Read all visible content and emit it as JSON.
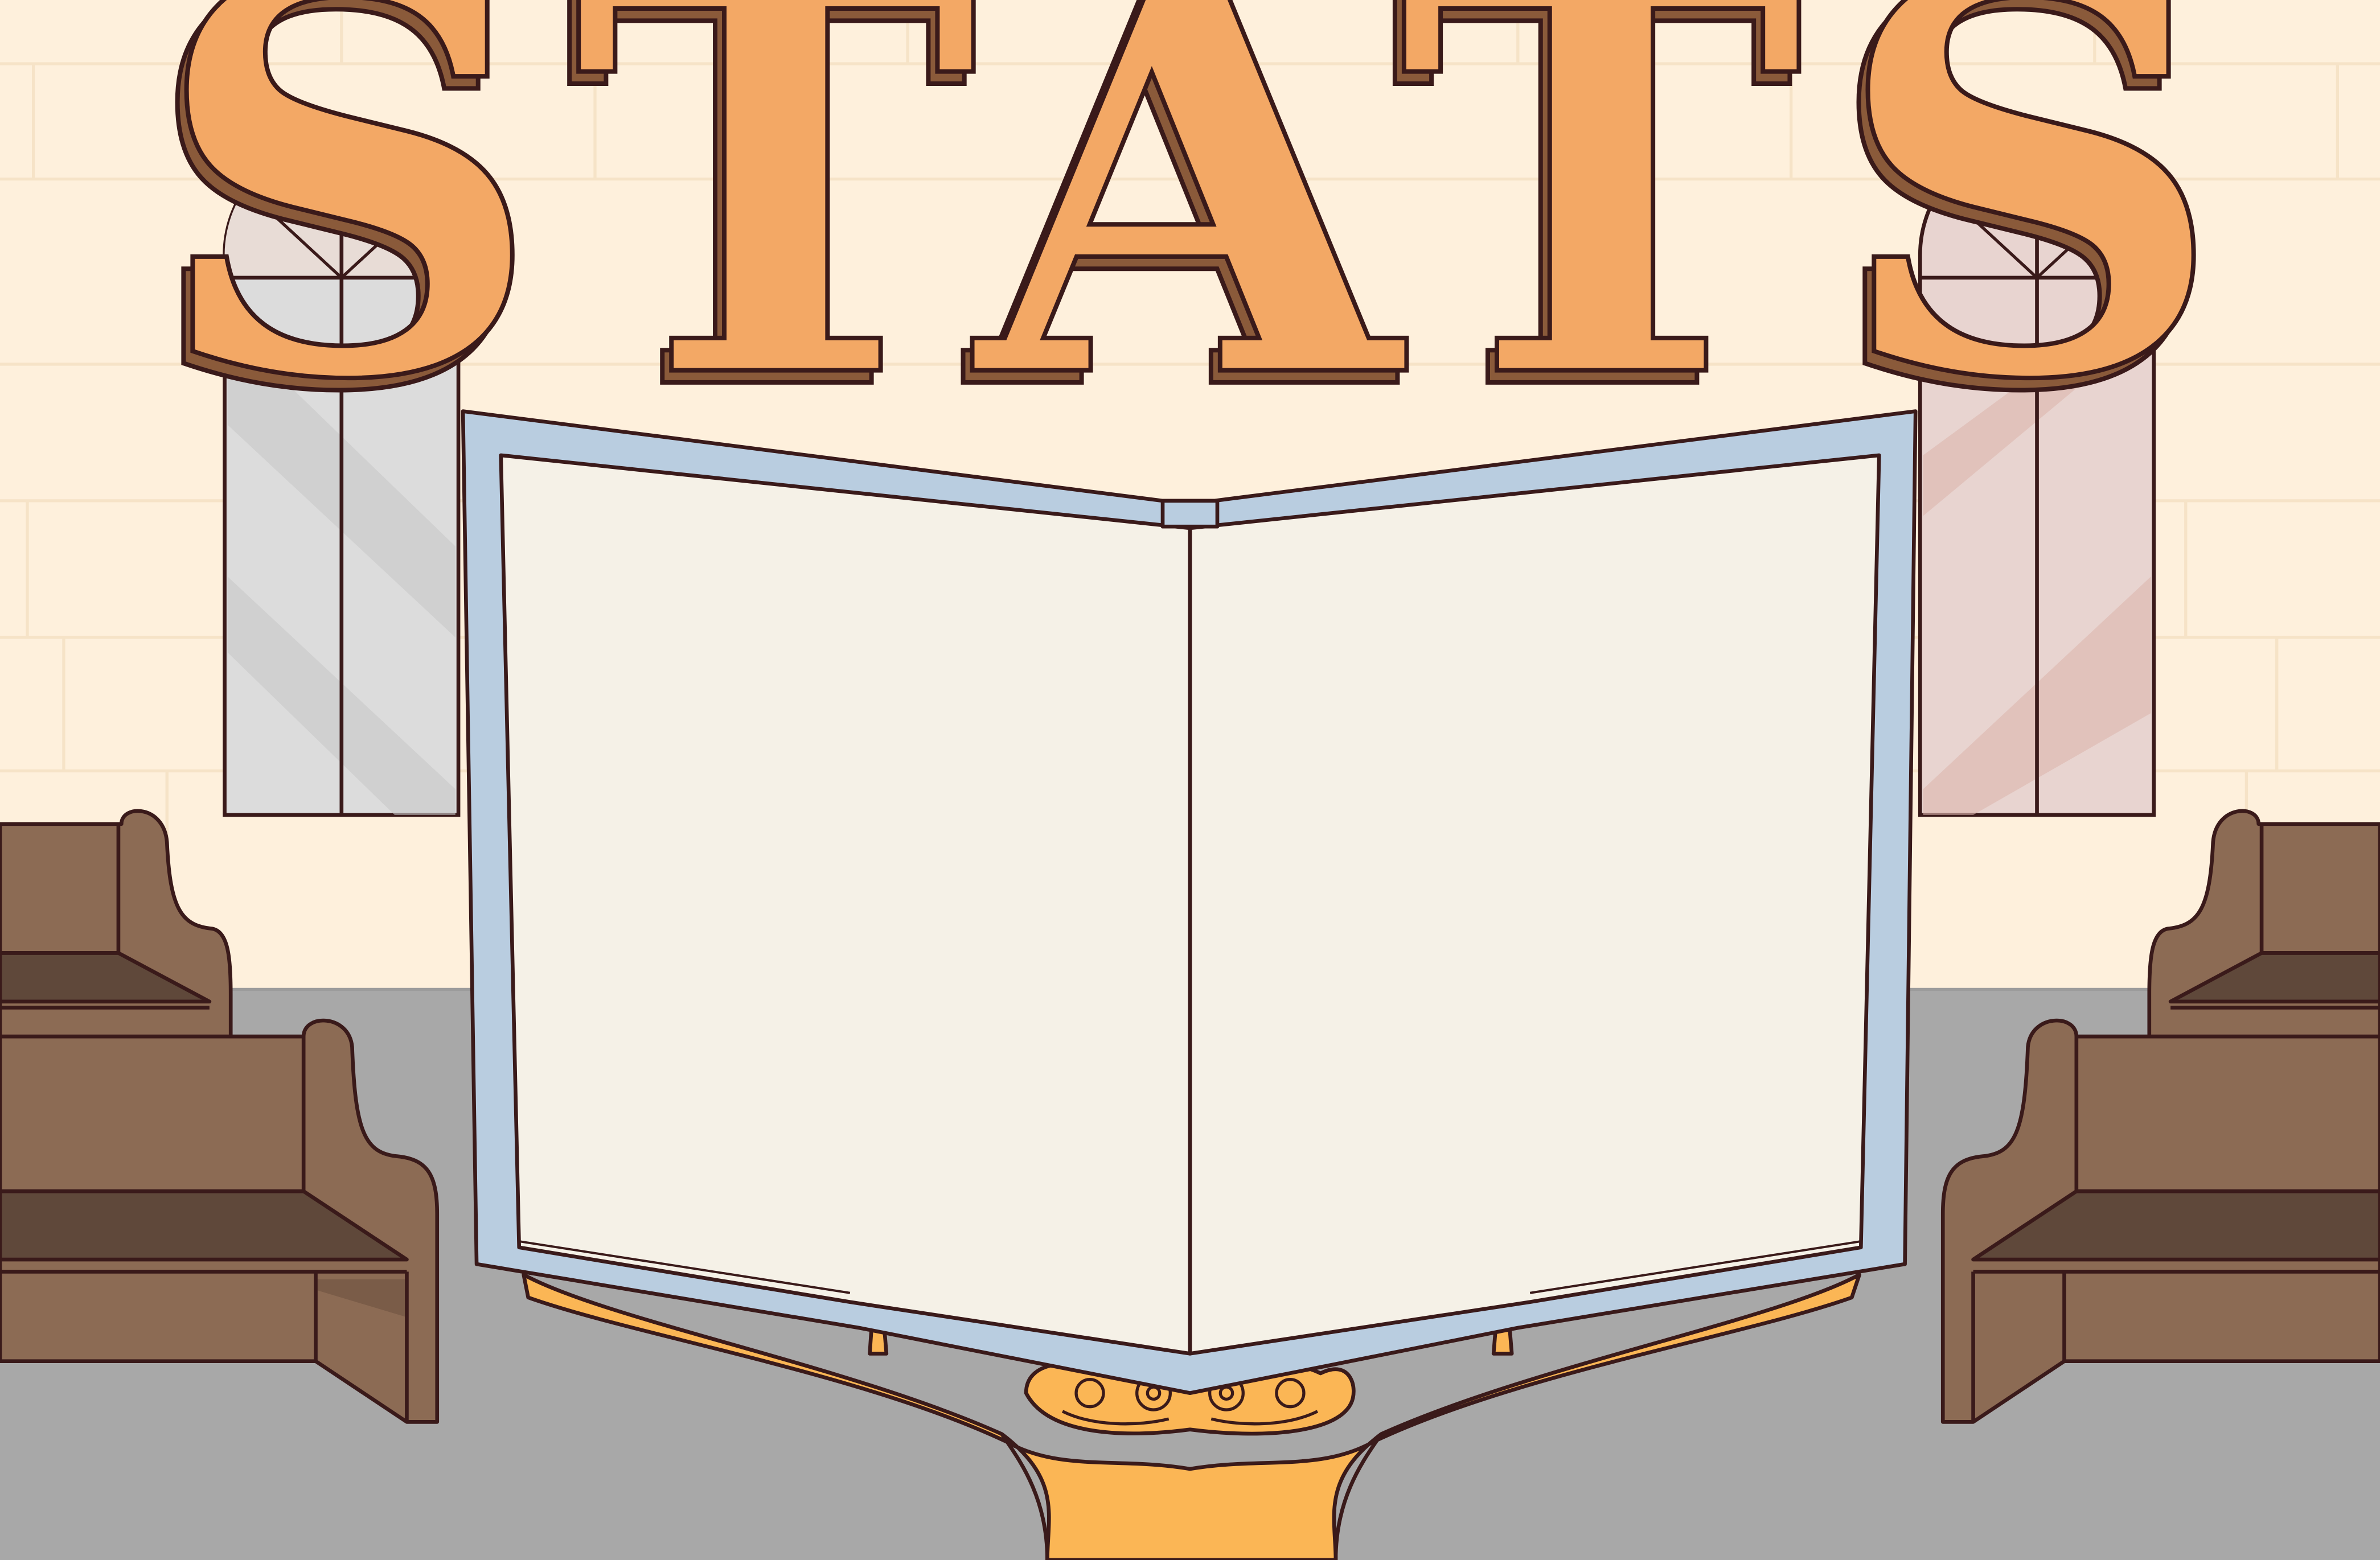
{
  "screen": {
    "title": "STATS"
  },
  "colors": {
    "wall": "#fef0dc",
    "wall_lines": "#f7e3c6",
    "floor": "#a8a8a8",
    "outline": "#3a1a1a",
    "title_fill": "#f3a865",
    "title_shadow": "#8a5a3a",
    "book_cover": "#b9cde0",
    "book_page": "#f5f1e7",
    "lectern": "#fbb655",
    "pew_main": "#8c6b54",
    "pew_dark": "#5f483a",
    "window_left_glass": "#dcdcdc",
    "window_right_glass": "#e8d4d0"
  },
  "book": {
    "left_page_text": "",
    "right_page_text": ""
  }
}
